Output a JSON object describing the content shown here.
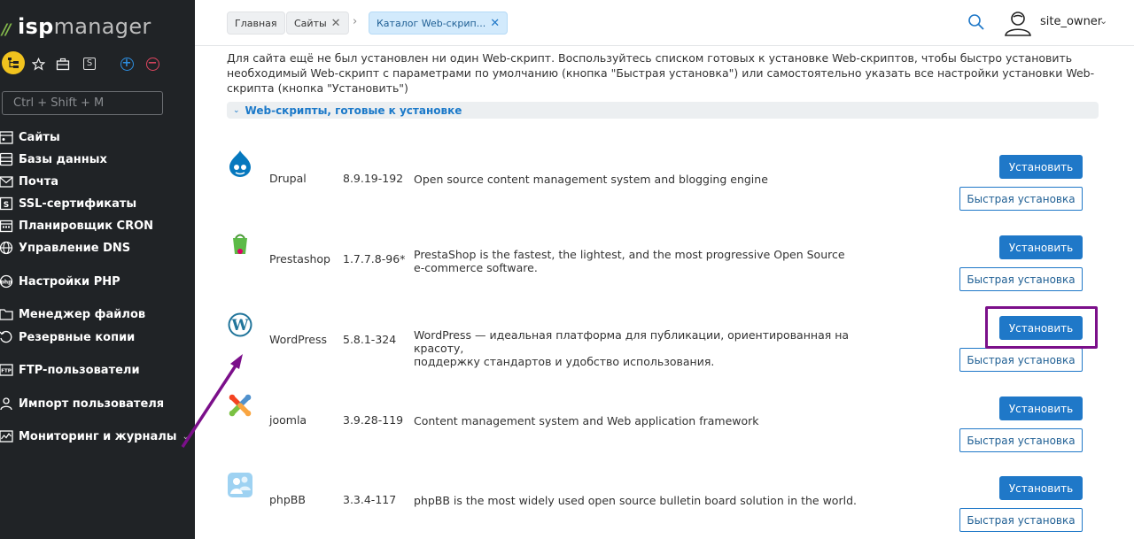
{
  "app": {
    "logo_prefix": "isp",
    "logo_suffix": "manager"
  },
  "colors": {
    "sidebar_bg": "#202326",
    "accent": "#1f78c8",
    "highlight": "#7b0f8a",
    "active_quick": "#f1c31e"
  },
  "sidebar": {
    "shortcut_placeholder": "Ctrl + Shift + M",
    "quick_icons": [
      "sites-tree-icon",
      "star-icon",
      "briefcase-icon",
      "s-box-icon",
      "plus-circle-icon",
      "minus-circle-icon"
    ],
    "items": [
      {
        "label": "Сайты",
        "icon": "sites-icon"
      },
      {
        "label": "Базы данных",
        "icon": "database-icon"
      },
      {
        "label": "Почта",
        "icon": "mail-icon"
      },
      {
        "label": "SSL-сертификаты",
        "icon": "ssl-icon"
      },
      {
        "label": "Планировщик CRON",
        "icon": "calendar-icon"
      },
      {
        "label": "Управление DNS",
        "icon": "globe-icon"
      },
      {
        "label": "Настройки PHP",
        "icon": "php-icon"
      },
      {
        "label": "Менеджер файлов",
        "icon": "folder-icon"
      },
      {
        "label": "Резервные копии",
        "icon": "backup-icon"
      },
      {
        "label": "FTP-пользователи",
        "icon": "ftp-icon"
      },
      {
        "label": "Импорт пользователя",
        "icon": "import-user-icon"
      },
      {
        "label": "Мониторинг и журналы",
        "icon": "monitoring-icon"
      }
    ]
  },
  "header": {
    "breadcrumbs": [
      {
        "label": "Главная"
      },
      {
        "label": "Сайты"
      },
      {
        "label": "Каталог Web-скрип..."
      }
    ],
    "separator": "›",
    "user": "site_owner"
  },
  "main": {
    "intro": "Для сайта ещё не был установлен ни один Web-скрипт. Воспользуйтесь списком готовых к установке Web-скриптов, чтобы быстро установить необходимый Web-скрипт с параметрами по умолчанию (кнопка \"Быстрая установка\") или самостоятельно указать все настройки установки Web-скрипта (кнопка \"Установить\")",
    "section_title": "Web-скрипты, готовые к установке",
    "install_label": "Установить",
    "quick_label": "Быстрая установка",
    "scripts": [
      {
        "name": "Drupal",
        "version": "8.9.19-192",
        "desc1": "Open source content management system and blogging engine",
        "desc2": "",
        "icon": "drupal-icon"
      },
      {
        "name": "Prestashop",
        "version": "1.7.7.8-96*",
        "desc1": "PrestaShop is the fastest, the lightest, and the most progressive Open Source",
        "desc2": "e-commerce software.",
        "icon": "prestashop-icon"
      },
      {
        "name": "WordPress",
        "version": "5.8.1-324",
        "desc1": "WordPress — идеальная платформа для публикации, ориентированная на красоту,",
        "desc2": "поддержку стандартов и удобство использования.",
        "icon": "wordpress-icon"
      },
      {
        "name": "joomla",
        "version": "3.9.28-119",
        "desc1": "Content management system and Web application framework",
        "desc2": "",
        "icon": "joomla-icon"
      },
      {
        "name": "phpBB",
        "version": "3.3.4-117",
        "desc1": "phpBB is the most widely used open source bulletin board solution in the world.",
        "desc2": "",
        "icon": "phpbb-icon"
      }
    ]
  }
}
